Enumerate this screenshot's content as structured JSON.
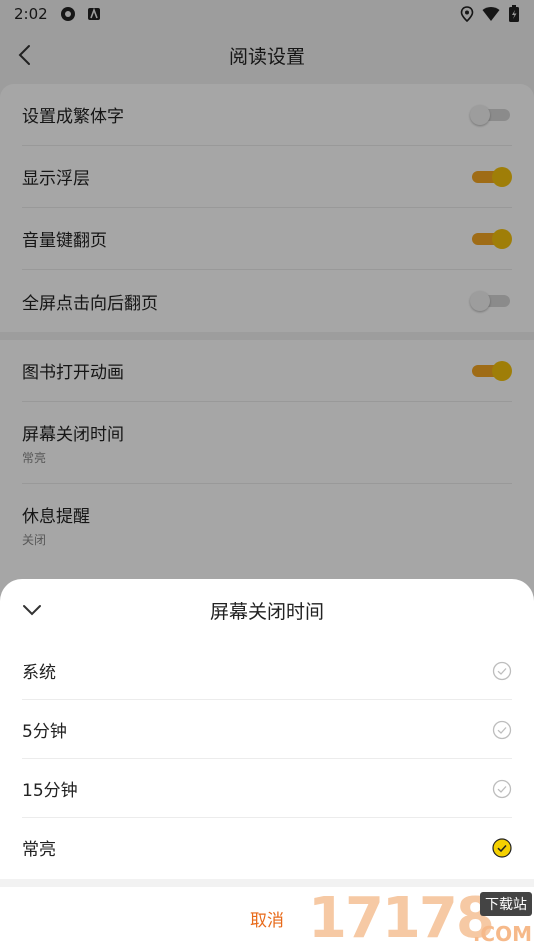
{
  "status_bar": {
    "time": "2:02"
  },
  "header": {
    "title": "阅读设置"
  },
  "settings": {
    "group1": [
      {
        "label": "设置成繁体字",
        "toggle": "off"
      },
      {
        "label": "显示浮层",
        "toggle": "on"
      },
      {
        "label": "音量键翻页",
        "toggle": "on"
      },
      {
        "label": "全屏点击向后翻页",
        "toggle": "off"
      }
    ],
    "group2": [
      {
        "label": "图书打开动画",
        "toggle": "on"
      },
      {
        "label": "屏幕关闭时间",
        "value": "常亮"
      },
      {
        "label": "休息提醒",
        "value": "关闭"
      }
    ]
  },
  "sheet": {
    "title": "屏幕关闭时间",
    "options": [
      {
        "label": "系统",
        "selected": false
      },
      {
        "label": "5分钟",
        "selected": false
      },
      {
        "label": "15分钟",
        "selected": false
      },
      {
        "label": "常亮",
        "selected": true
      }
    ],
    "cancel_label": "取消"
  },
  "watermark": {
    "digits": "17178",
    "badge": "下载站",
    "suffix": ".COM"
  },
  "colors": {
    "accent_orange": "#e86a1a",
    "toggle_on": "#f5a623",
    "check_selected": "#f4d000"
  }
}
